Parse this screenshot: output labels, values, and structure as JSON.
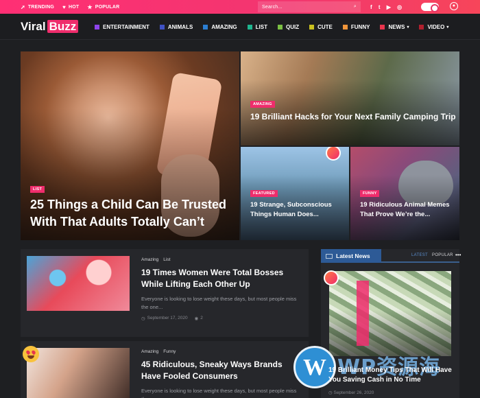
{
  "topbar": {
    "items": [
      {
        "icon": "trending-icon",
        "label": "TRENDING"
      },
      {
        "icon": "heart-icon",
        "label": "HOT"
      },
      {
        "icon": "star-icon",
        "label": "POPULAR"
      }
    ],
    "search_placeholder": "Search...",
    "socials": [
      "facebook-icon",
      "twitter-icon",
      "youtube-icon",
      "instagram-icon"
    ]
  },
  "header": {
    "logo_part1": "Viral",
    "logo_part2": "Buzz",
    "nav": [
      {
        "label": "ENTERTAINMENT",
        "color": "#8e44ec"
      },
      {
        "label": "ANIMALS",
        "color": "#3f51c4"
      },
      {
        "label": "AMAZING",
        "color": "#2b7ed2"
      },
      {
        "label": "LIST",
        "color": "#1fb58f"
      },
      {
        "label": "QUIZ",
        "color": "#7bc043"
      },
      {
        "label": "CUTE",
        "color": "#c9c01e"
      },
      {
        "label": "FUNNY",
        "color": "#f0953a"
      },
      {
        "label": "NEWS",
        "color": "#e8354d"
      },
      {
        "label": "VIDEO",
        "color": "#b0202e"
      }
    ]
  },
  "hero": {
    "main": {
      "badge": "LIST",
      "title": "25 Things a Child Can Be Trusted With That Adults Totally Can’t"
    },
    "top_right": {
      "badge": "AMAZING",
      "title": "19 Brilliant Hacks for Your Next Family Camping Trip"
    },
    "bottom_mid": {
      "badge": "FEATURED",
      "title": "19 Strange, Subconscious Things Human Does..."
    },
    "bottom_right": {
      "badge": "FUNNY",
      "title": "19 Ridiculous Animal Memes That Prove We’re the..."
    }
  },
  "posts": [
    {
      "tags": [
        "Amazing",
        "List"
      ],
      "title": "19 Times Women Were Total Bosses While Lifting Each Other Up",
      "excerpt": "Everyone is looking to lose weight these days, but most people miss the one...",
      "date": "September 17, 2020",
      "views": "2"
    },
    {
      "tags": [
        "Amazing",
        "Funny"
      ],
      "title": "45 Ridiculous, Sneaky Ways Brands Have Fooled Consumers",
      "excerpt": "Everyone is looking to lose weight these days, but most people miss the one..."
    }
  ],
  "sidebar": {
    "tab": "Latest News",
    "link_latest": "LATEST",
    "link_popular": "POPULAR",
    "more": "•••",
    "item_title": "19 Brilliant Money Tips That Will Have You Saving Cash in No Time",
    "item_date": "September 26, 2020"
  },
  "watermark": {
    "logo": "W",
    "text": "WP资源海"
  }
}
